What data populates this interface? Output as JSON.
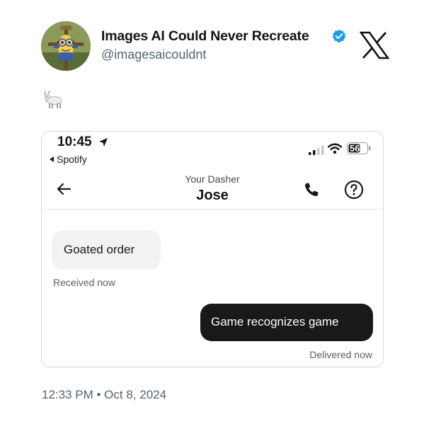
{
  "post": {
    "display_name": "Images AI Could Never Recreate",
    "handle": "@imagesaicouldnt",
    "timestamp": "12:33 PM • Oct 8, 2024",
    "text_emoji": "goat-emoji"
  },
  "colors": {
    "verified_blue": "#1d9bf0",
    "muted_text": "#536471",
    "outgoing_bubble": "#191919",
    "incoming_bubble": "#f2f2f2"
  },
  "phone": {
    "status_bar": {
      "time": "10:45",
      "back_app": "Spotify",
      "battery": "56"
    },
    "header": {
      "label": "Your Dasher",
      "name": "Jose"
    },
    "messages": {
      "incoming_text": "Goated order",
      "incoming_status": "Received now",
      "outgoing_text": "Game recognizes game",
      "outgoing_status": "Delivered now"
    }
  }
}
